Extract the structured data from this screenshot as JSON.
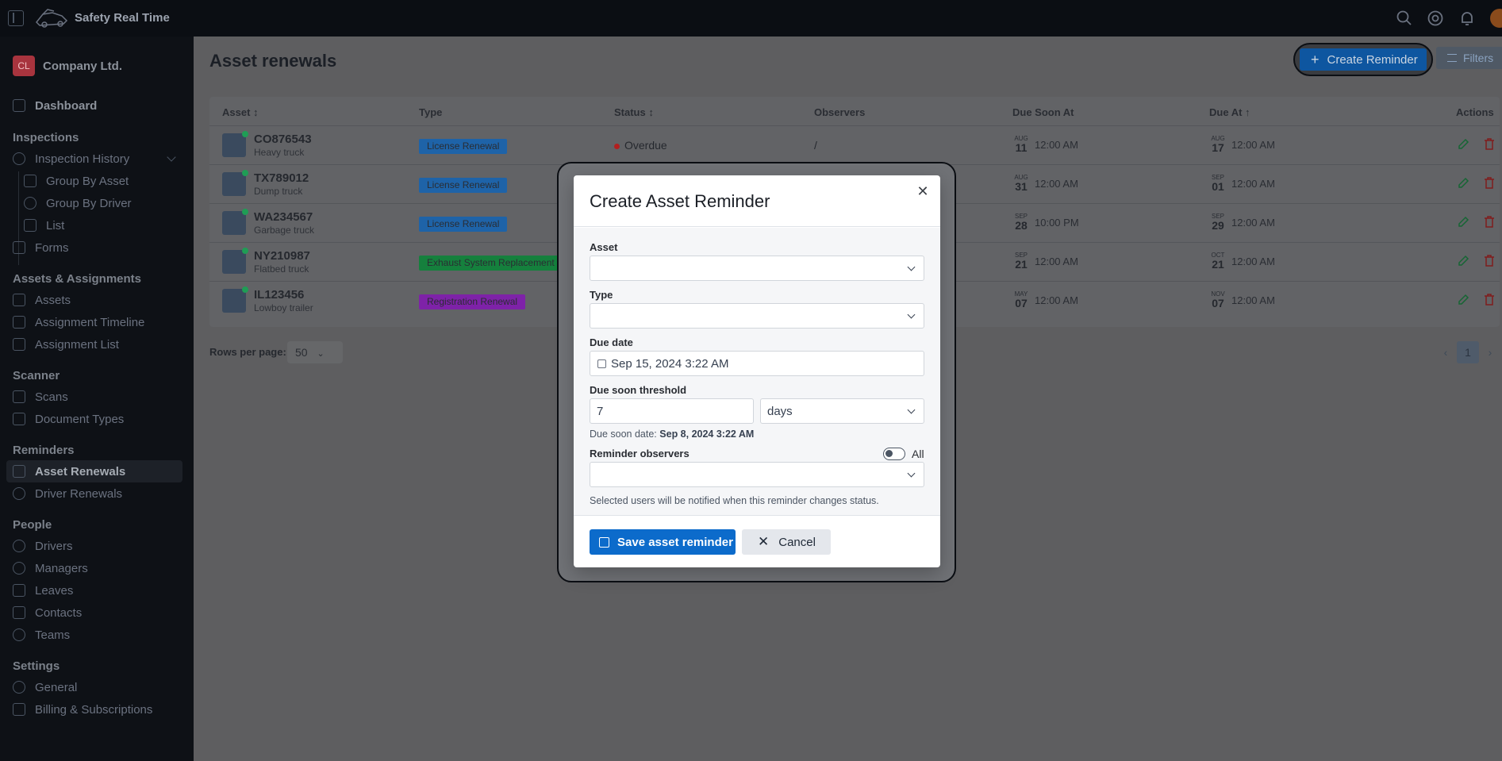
{
  "app": {
    "brand": "Safety Real Time"
  },
  "company": {
    "initials": "CL",
    "name": "Company Ltd."
  },
  "sidebar": {
    "dashboard": "Dashboard",
    "inspections": {
      "title": "Inspections",
      "history": "Inspection History",
      "group_asset": "Group By Asset",
      "group_driver": "Group By Driver",
      "list": "List",
      "forms": "Forms"
    },
    "assets": {
      "title": "Assets & Assignments",
      "assets": "Assets",
      "timeline": "Assignment Timeline",
      "list": "Assignment List"
    },
    "scanner": {
      "title": "Scanner",
      "scans": "Scans",
      "doc_types": "Document Types"
    },
    "reminders": {
      "title": "Reminders",
      "asset_renewals": "Asset Renewals",
      "driver_renewals": "Driver Renewals"
    },
    "people": {
      "title": "People",
      "drivers": "Drivers",
      "managers": "Managers",
      "leaves": "Leaves",
      "contacts": "Contacts",
      "teams": "Teams"
    },
    "settings": {
      "title": "Settings",
      "general": "General",
      "billing": "Billing & Subscriptions"
    }
  },
  "page": {
    "title": "Asset renewals",
    "create_btn": "Create Reminder",
    "filters_btn": "Filters",
    "columns": {
      "asset": "Asset",
      "type": "Type",
      "status": "Status",
      "observers": "Observers",
      "due_soon": "Due Soon At",
      "due_at": "Due At",
      "actions": "Actions"
    },
    "rows": [
      {
        "id": "CO876543",
        "kind": "Heavy truck",
        "type": "License Renewal",
        "type_color": "#1e63a8",
        "status": "Overdue",
        "observers": "/",
        "soon_mon": "AUG",
        "soon_day": "11",
        "soon_time": "12:00 AM",
        "due_mon": "AUG",
        "due_day": "17",
        "due_time": "12:00 AM"
      },
      {
        "id": "TX789012",
        "kind": "Dump truck",
        "type": "License Renewal",
        "type_color": "#1e63a8",
        "status": "",
        "observers": "",
        "soon_mon": "AUG",
        "soon_day": "31",
        "soon_time": "12:00 AM",
        "due_mon": "SEP",
        "due_day": "01",
        "due_time": "12:00 AM"
      },
      {
        "id": "WA234567",
        "kind": "Garbage truck",
        "type": "License Renewal",
        "type_color": "#1e63a8",
        "status": "",
        "observers": "",
        "soon_mon": "SEP",
        "soon_day": "28",
        "soon_time": "10:00 PM",
        "due_mon": "SEP",
        "due_day": "29",
        "due_time": "12:00 AM"
      },
      {
        "id": "NY210987",
        "kind": "Flatbed truck",
        "type": "Exhaust System Replacement",
        "type_color": "#15803d",
        "status": "",
        "observers": "",
        "soon_mon": "SEP",
        "soon_day": "21",
        "soon_time": "12:00 AM",
        "due_mon": "OCT",
        "due_day": "21",
        "due_time": "12:00 AM"
      },
      {
        "id": "IL123456",
        "kind": "Lowboy trailer",
        "type": "Registration Renewal",
        "type_color": "#7e22a8",
        "status": "",
        "observers": "",
        "soon_mon": "MAY",
        "soon_day": "07",
        "soon_time": "12:00 AM",
        "due_mon": "NOV",
        "due_day": "07",
        "due_time": "12:00 AM"
      }
    ],
    "rows_per_page_label": "Rows per page:",
    "rows_per_page": "50",
    "current_page": "1"
  },
  "modal": {
    "title": "Create Asset Reminder",
    "asset_label": "Asset",
    "type_label": "Type",
    "due_date_label": "Due date",
    "due_date_value": "Sep 15, 2024 3:22 AM",
    "threshold_label": "Due soon threshold",
    "threshold_value": "7",
    "threshold_unit": "days",
    "due_soon_prefix": "Due soon date:",
    "due_soon_value": "Sep 8, 2024 3:22 AM",
    "observers_label": "Reminder observers",
    "all_label": "All",
    "observers_hint": "Selected users will be notified when this reminder changes status.",
    "save_btn": "Save asset reminder",
    "cancel_btn": "Cancel"
  }
}
